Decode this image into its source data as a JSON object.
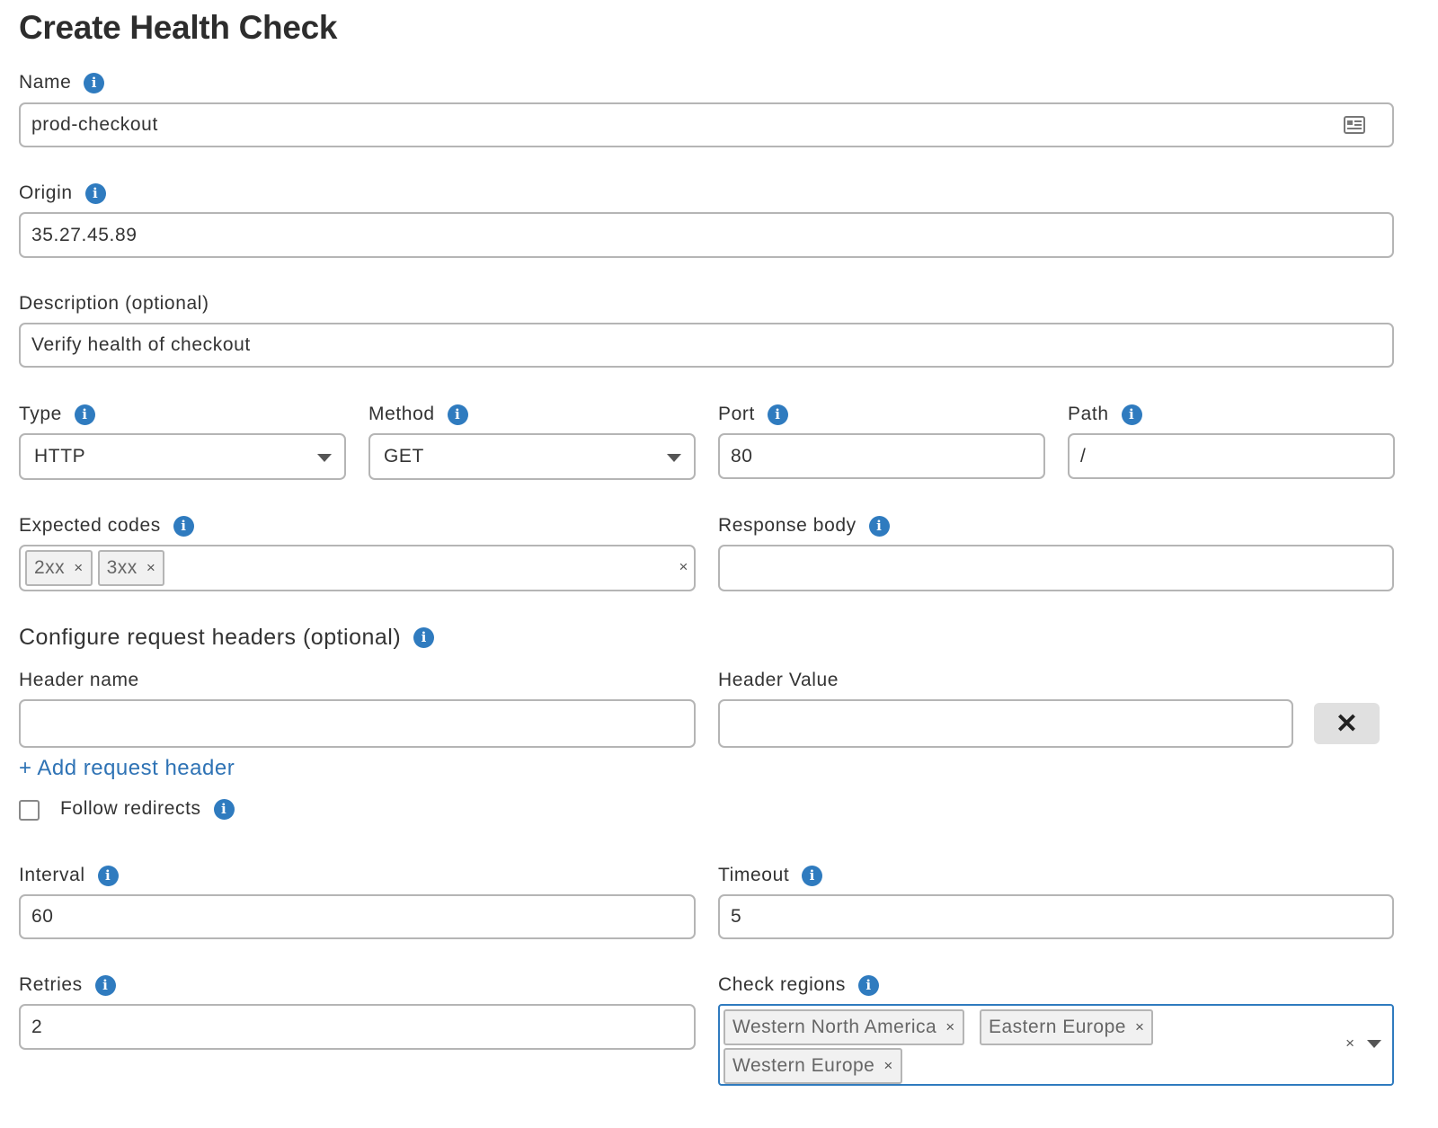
{
  "page": {
    "title": "Create Health Check"
  },
  "name": {
    "label": "Name",
    "value": "prod-checkout"
  },
  "origin": {
    "label": "Origin",
    "value": "35.27.45.89"
  },
  "description": {
    "label": "Description (optional)",
    "value": "Verify health of checkout"
  },
  "type": {
    "label": "Type",
    "value": "HTTP"
  },
  "method": {
    "label": "Method",
    "value": "GET"
  },
  "port": {
    "label": "Port",
    "value": "80"
  },
  "path": {
    "label": "Path",
    "value": "/"
  },
  "expected_codes": {
    "label": "Expected codes",
    "chips": [
      "2xx",
      "3xx"
    ],
    "remove_glyph": "×",
    "clear_glyph": "×"
  },
  "response_body": {
    "label": "Response body",
    "value": ""
  },
  "request_headers": {
    "section_title": "Configure request headers (optional)",
    "header_name_label": "Header name",
    "header_value_label": "Header Value",
    "header_name_value": "",
    "header_value_value": "",
    "remove_glyph": "✕",
    "add_link": "+ Add request header"
  },
  "follow_redirects": {
    "label": "Follow redirects",
    "checked": false
  },
  "interval": {
    "label": "Interval",
    "value": "60"
  },
  "timeout": {
    "label": "Timeout",
    "value": "5"
  },
  "retries": {
    "label": "Retries",
    "value": "2"
  },
  "check_regions": {
    "label": "Check regions",
    "chips": [
      "Western North America",
      "Eastern Europe",
      "Western Europe"
    ],
    "remove_glyph": "×",
    "clear_glyph": "×"
  },
  "icons": {
    "info": "info-icon",
    "autofill": "contact-card-icon",
    "dropdown": "caret-down-icon"
  },
  "colors": {
    "accent": "#2f7bbf",
    "link": "#2f73b5",
    "border": "#b5b5b5",
    "chip_bg": "#f1f1f1",
    "focus_border": "#2f7bbf"
  }
}
